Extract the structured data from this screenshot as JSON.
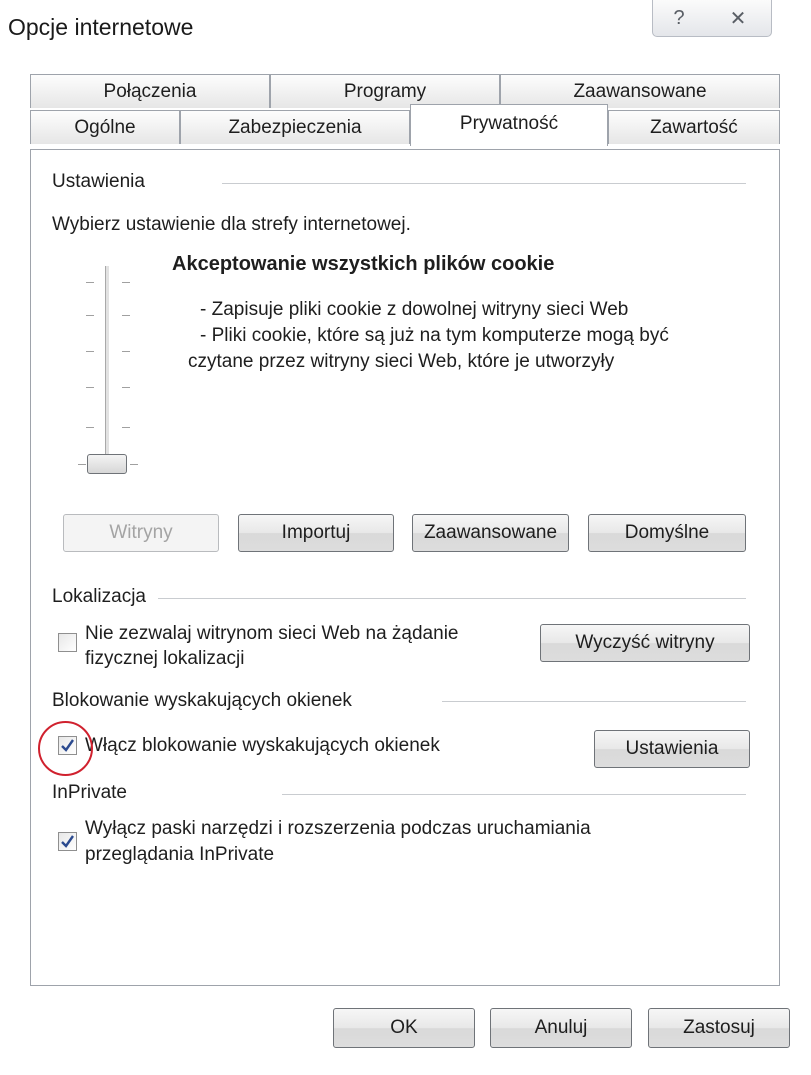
{
  "window": {
    "title": "Opcje internetowe",
    "help_glyph": "?",
    "close_glyph": "✕"
  },
  "tabs": {
    "row1": [
      "Połączenia",
      "Programy",
      "Zaawansowane"
    ],
    "row2": [
      "Ogólne",
      "Zabezpieczenia",
      "Prywatność",
      "Zawartość"
    ],
    "active": "Prywatność"
  },
  "settings": {
    "group_label": "Ustawienia",
    "instruction": "Wybierz ustawienie dla strefy internetowej.",
    "level_title": "Akceptowanie wszystkich plików cookie",
    "desc_line1": "- Zapisuje pliki cookie z dowolnej witryny sieci Web",
    "desc_line2": "- Pliki cookie, które są już na tym komputerze mogą być",
    "desc_line3": "czytane przez witryny sieci Web, które je utworzyły",
    "slider_level": 0,
    "buttons": {
      "sites": "Witryny",
      "import": "Importuj",
      "advanced": "Zaawansowane",
      "defaults": "Domyślne"
    }
  },
  "location": {
    "group_label": "Lokalizacja",
    "checkbox_line1": "Nie zezwalaj witrynom sieci Web na żądanie",
    "checkbox_line2": "fizycznej lokalizacji",
    "checked": false,
    "clear_button": "Wyczyść witryny"
  },
  "popup": {
    "group_label": "Blokowanie wyskakujących okienek",
    "checkbox_label": "Włącz blokowanie wyskakujących okienek",
    "checked": true,
    "settings_button": "Ustawienia"
  },
  "inprivate": {
    "group_label": "InPrivate",
    "checkbox_line1": "Wyłącz paski narzędzi i rozszerzenia podczas uruchamiania",
    "checkbox_line2": "przeglądania InPrivate",
    "checked": true
  },
  "footer": {
    "ok": "OK",
    "cancel": "Anuluj",
    "apply": "Zastosuj"
  },
  "colors": {
    "highlight_circle": "#d0212e",
    "check_mark": "#2b4a8f"
  }
}
